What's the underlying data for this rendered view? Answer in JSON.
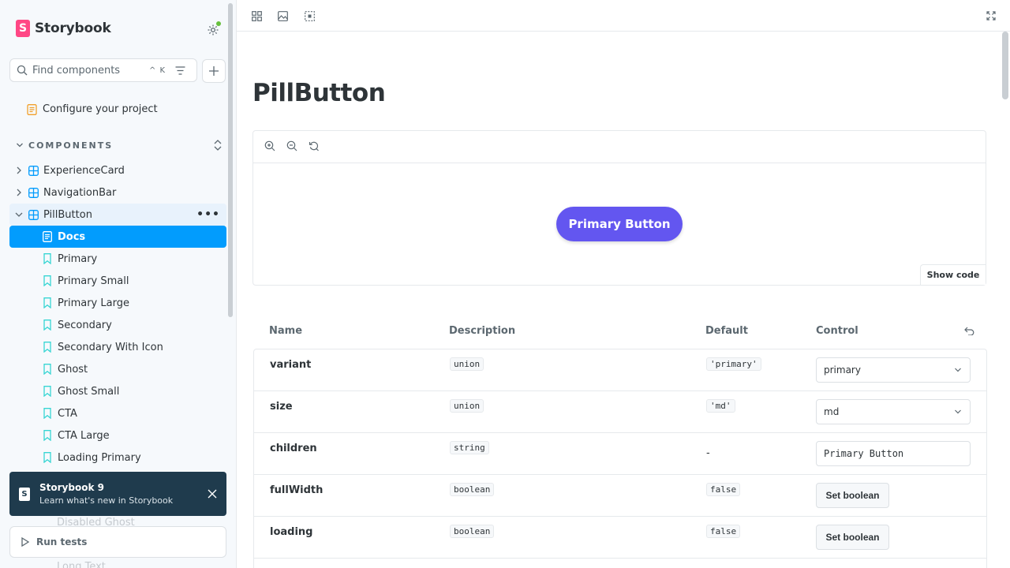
{
  "sidebar": {
    "brand": "Storybook",
    "search_placeholder": "Find components",
    "search_shortcut": "^ K",
    "configure_label": "Configure your project",
    "section_label": "COMPONENTS",
    "components": [
      {
        "label": "ExperienceCard"
      },
      {
        "label": "NavigationBar"
      },
      {
        "label": "PillButton"
      }
    ],
    "stories": [
      {
        "label": "Docs",
        "kind": "docs"
      },
      {
        "label": "Primary"
      },
      {
        "label": "Primary Small"
      },
      {
        "label": "Primary Large"
      },
      {
        "label": "Secondary"
      },
      {
        "label": "Secondary With Icon"
      },
      {
        "label": "Ghost"
      },
      {
        "label": "Ghost Small"
      },
      {
        "label": "CTA"
      },
      {
        "label": "CTA Large"
      },
      {
        "label": "Loading Primary"
      }
    ],
    "hidden_items": [
      "Disabled Ghost",
      "Long Text"
    ],
    "toast": {
      "title": "Storybook 9",
      "subtitle": "Learn what's new in Storybook"
    },
    "run_tests": "Run tests"
  },
  "main": {
    "title": "PillButton",
    "preview_button": "Primary Button",
    "show_code": "Show code",
    "args_headers": {
      "name": "Name",
      "description": "Description",
      "default": "Default",
      "control": "Control"
    },
    "rows": [
      {
        "name": "variant",
        "type": "union",
        "default": "'primary'",
        "control": "primary"
      },
      {
        "name": "size",
        "type": "union",
        "default": "'md'",
        "control": "md"
      },
      {
        "name": "children",
        "type": "string",
        "default": "-",
        "control": "Primary Button"
      },
      {
        "name": "fullWidth",
        "type": "boolean",
        "default": "false",
        "control": "Set boolean"
      },
      {
        "name": "loading",
        "type": "boolean",
        "default": "false",
        "control": "Set boolean"
      }
    ]
  },
  "colors": {
    "accent": "#029cfd",
    "brand": "#ff4785",
    "pill": "#6356f0",
    "toast": "#1f3b4d"
  }
}
